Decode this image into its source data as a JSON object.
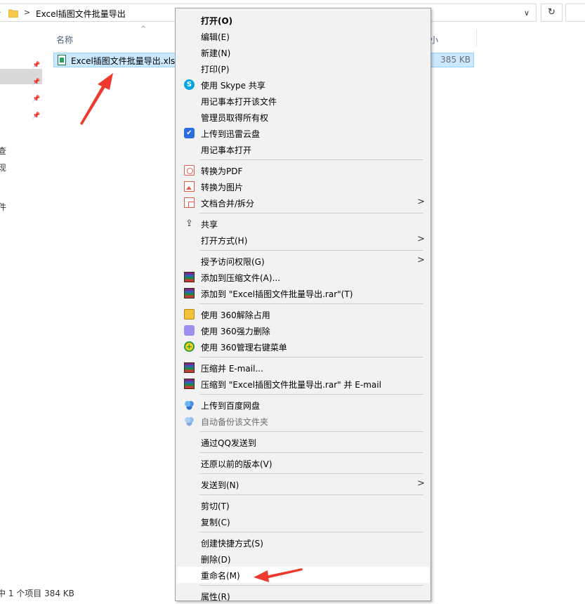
{
  "explorer": {
    "left_truncated": "-",
    "address_chevron": ">",
    "address_path": "Excel插图文件批量导出",
    "address_dropdown": "∨",
    "refresh_symbol": "↻",
    "column_name": "名称",
    "column_size_partial": "小",
    "sort_indicator": "^",
    "file": {
      "name": "Excel插图文件批量导出.xlsx",
      "size": "385 KB"
    },
    "nav_fragments": [
      "查",
      "现",
      "件"
    ],
    "status_bar": "中 1 个项目   384 KB"
  },
  "context_menu": {
    "items": [
      {
        "label": "打开(O)",
        "bold": true
      },
      {
        "label": "编辑(E)"
      },
      {
        "label": "新建(N)"
      },
      {
        "label": "打印(P)"
      },
      {
        "label": "使用 Skype 共享",
        "icon": "skype-icon",
        "icon_glyph": "S"
      },
      {
        "label": "用记事本打开该文件"
      },
      {
        "label": "管理员取得所有权"
      },
      {
        "label": "上传到迅雷云盘",
        "icon": "thunder-icon",
        "icon_glyph": "✔"
      },
      {
        "label": "用记事本打开"
      },
      {
        "label": "转换为PDF",
        "icon": "pdf-convert-icon"
      },
      {
        "label": "转换为图片",
        "icon": "image-convert-icon"
      },
      {
        "label": "文档合并/拆分",
        "icon": "merge-split-icon",
        "submenu": true
      },
      {
        "label": "共享",
        "icon": "share-icon",
        "icon_glyph": "⇪"
      },
      {
        "label": "打开方式(H)",
        "submenu": true
      },
      {
        "label": "授予访问权限(G)",
        "submenu": true
      },
      {
        "label": "添加到压缩文件(A)...",
        "icon": "winrar-icon"
      },
      {
        "label": "添加到 \"Excel插图文件批量导出.rar\"(T)",
        "icon": "winrar-icon"
      },
      {
        "label": "使用 360解除占用",
        "icon": "360-unlock-icon"
      },
      {
        "label": "使用 360强力删除",
        "icon": "360-delete-icon"
      },
      {
        "label": "使用 360管理右键菜单",
        "icon": "360-menu-icon",
        "icon_glyph": "+"
      },
      {
        "label": "压缩并 E-mail...",
        "icon": "winrar-icon"
      },
      {
        "label": "压缩到 \"Excel插图文件批量导出.rar\" 并 E-mail",
        "icon": "winrar-icon"
      },
      {
        "label": "上传到百度网盘",
        "icon": "baidu-cloud-icon"
      },
      {
        "label": "自动备份该文件夹",
        "icon": "baidu-cloud-icon",
        "disabled": true
      },
      {
        "label": "通过QQ发送到"
      },
      {
        "label": "还原以前的版本(V)"
      },
      {
        "label": "发送到(N)",
        "submenu": true
      },
      {
        "label": "剪切(T)"
      },
      {
        "label": "复制(C)"
      },
      {
        "label": "创建快捷方式(S)"
      },
      {
        "label": "删除(D)"
      },
      {
        "label": "重命名(M)",
        "highlighted": true
      },
      {
        "label": "属性(R)"
      }
    ],
    "submenu_glyph": ">"
  },
  "colors": {
    "menu_bg": "#f2f2f2",
    "selection_bg": "#cce8ff",
    "annotation_arrow": "#ee3a2e"
  }
}
